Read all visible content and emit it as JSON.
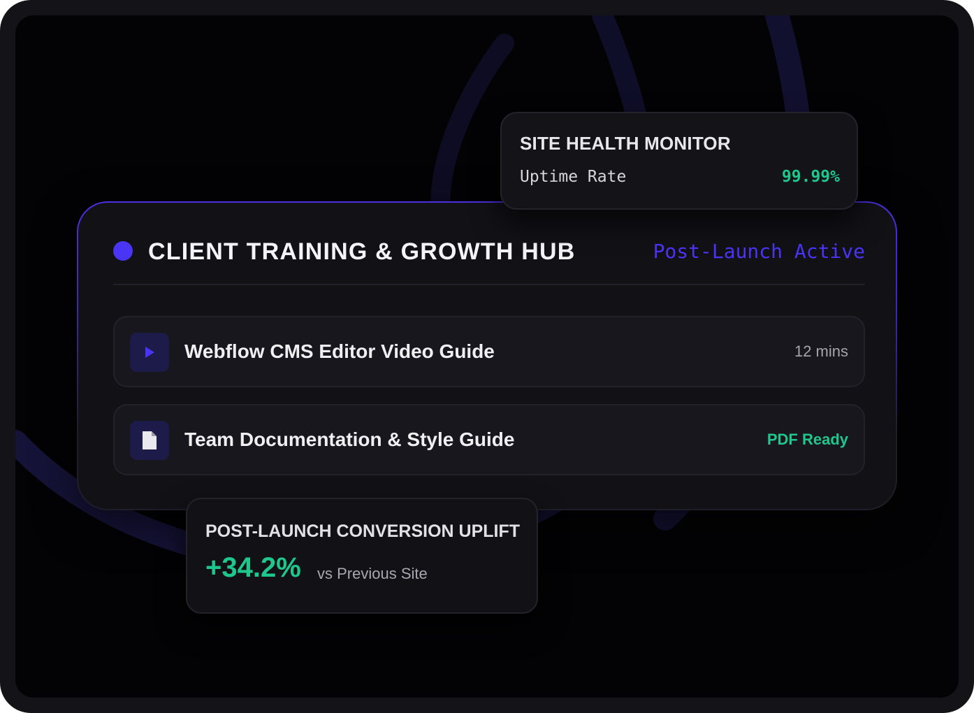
{
  "hub": {
    "title": "CLIENT TRAINING & GROWTH HUB",
    "status": "Post-Launch Active",
    "items": [
      {
        "icon": "play-icon",
        "label": "Webflow CMS Editor Video Guide",
        "meta": "12 mins"
      },
      {
        "icon": "document-icon",
        "label": "Team Documentation & Style Guide",
        "meta": "PDF Ready"
      }
    ]
  },
  "health": {
    "title": "SITE HEALTH MONITOR",
    "metric_label": "Uptime Rate",
    "metric_value": "99.99%"
  },
  "conversion": {
    "title": "POST-LAUNCH CONVERSION UPLIFT",
    "value": "+34.2%",
    "comparison": "vs Previous Site"
  },
  "colors": {
    "accent": "#4a35f5",
    "success": "#1fc78d",
    "background": "#030305",
    "card": "#121116"
  }
}
